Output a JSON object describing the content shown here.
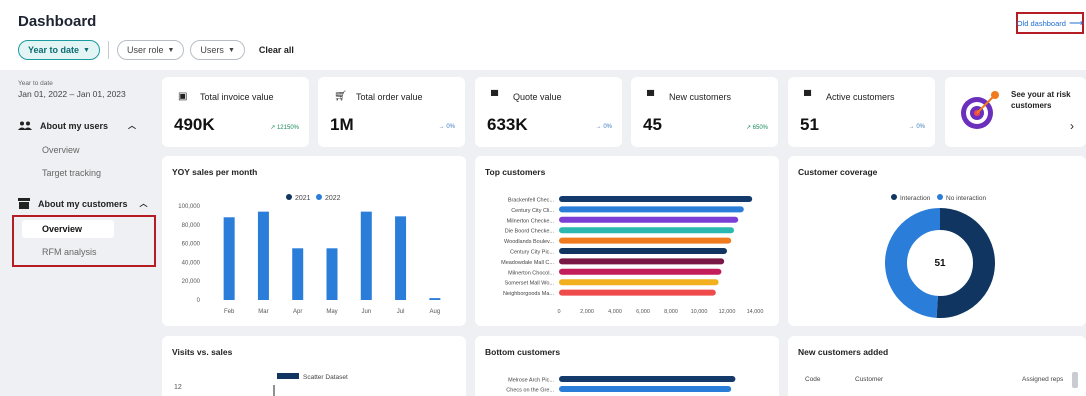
{
  "header": {
    "title": "Dashboard",
    "old_dashboard_label": "Old dashboard",
    "filters": [
      {
        "label": "Year to date"
      },
      {
        "label": "User role"
      },
      {
        "label": "Users"
      }
    ],
    "clear_all_label": "Clear all"
  },
  "sidebar": {
    "range_caption": "Year to date",
    "range_value": "Jan 01, 2022 – Jan 01, 2023",
    "groups": [
      {
        "label": "About my users",
        "items": [
          "Overview",
          "Target tracking"
        ]
      },
      {
        "label": "About my customers",
        "items": [
          "Overview",
          "RFM analysis"
        ]
      }
    ]
  },
  "kpis": [
    {
      "label": "Total invoice value",
      "value": "490K",
      "delta": "12150%",
      "icon": "invoice-icon"
    },
    {
      "label": "Total order value",
      "value": "1M",
      "delta": "0%",
      "icon": "cart-icon"
    },
    {
      "label": "Quote value",
      "value": "633K",
      "delta": "0%",
      "icon": "quote-icon"
    },
    {
      "label": "New customers",
      "value": "45",
      "delta": "650%",
      "icon": "store-icon"
    },
    {
      "label": "Active customers",
      "value": "51",
      "delta": "0%",
      "icon": "store-icon"
    }
  ],
  "risk_card": {
    "line1": "See your at risk",
    "line2": "customers"
  },
  "colors": {
    "accent": "#1b9aa0",
    "bar_blue": "#2a7dd8",
    "navy": "#0f3560",
    "highlight": "#b51c24"
  },
  "chart_data": [
    {
      "type": "bar",
      "title": "YOY sales per month",
      "categories": [
        "Feb",
        "Mar",
        "Apr",
        "May",
        "Jun",
        "Jul",
        "Aug"
      ],
      "series": [
        {
          "name": "2021",
          "values": [
            0,
            0,
            0,
            0,
            0,
            0,
            0
          ]
        },
        {
          "name": "2022",
          "values": [
            88000,
            94000,
            55000,
            55000,
            94000,
            89000,
            2000
          ]
        }
      ],
      "yticks": [
        "100,000",
        "80,000",
        "60,000",
        "40,000",
        "20,000",
        "0"
      ],
      "ylim": [
        0,
        100000
      ]
    },
    {
      "type": "bar",
      "title": "Top customers",
      "orientation": "horizontal",
      "categories": [
        "Brackenfell Chec...",
        "Century City Cli...",
        "Milnerton Checke...",
        "Die Boord Checke...",
        "Woodlands Boulev...",
        "Century City Pic...",
        "Meadowdale Mall C...",
        "Milnerton Chocol...",
        "Somerset Mall Wo...",
        "Neighborgoods Ma..."
      ],
      "values": [
        13800,
        13200,
        12800,
        12500,
        12300,
        12000,
        11800,
        11600,
        11400,
        11200
      ],
      "colors": [
        "#143a6b",
        "#2a7dd8",
        "#7b3fd6",
        "#2bb8b1",
        "#f07a1e",
        "#0f3560",
        "#7a1845",
        "#c41e5a",
        "#f2b01e",
        "#ef4b4b"
      ],
      "xticks": [
        "0",
        "2,000",
        "4,000",
        "6,000",
        "8,000",
        "10,000",
        "12,000",
        "14,000"
      ],
      "xlim": [
        0,
        14000
      ]
    },
    {
      "type": "pie",
      "title": "Customer coverage",
      "legend": [
        "Interaction",
        "No interaction"
      ],
      "values": [
        51,
        49
      ],
      "colors": [
        "#0f3560",
        "#2a7dd8"
      ],
      "center_label": "51"
    },
    {
      "type": "scatter",
      "title": "Visits vs. sales",
      "legend": [
        "Scatter Dataset"
      ],
      "yticks": [
        "12"
      ]
    },
    {
      "type": "bar",
      "title": "Bottom customers",
      "orientation": "horizontal",
      "categories": [
        "Melrose Arch Pic...",
        "Checs on the Gre..."
      ],
      "values": [
        12600,
        12300
      ],
      "colors": [
        "#143a6b",
        "#2a7dd8"
      ],
      "xlim": [
        0,
        14000
      ]
    }
  ],
  "new_customers": {
    "title": "New customers added",
    "columns": [
      "Code",
      "Customer",
      "Assigned reps"
    ]
  }
}
